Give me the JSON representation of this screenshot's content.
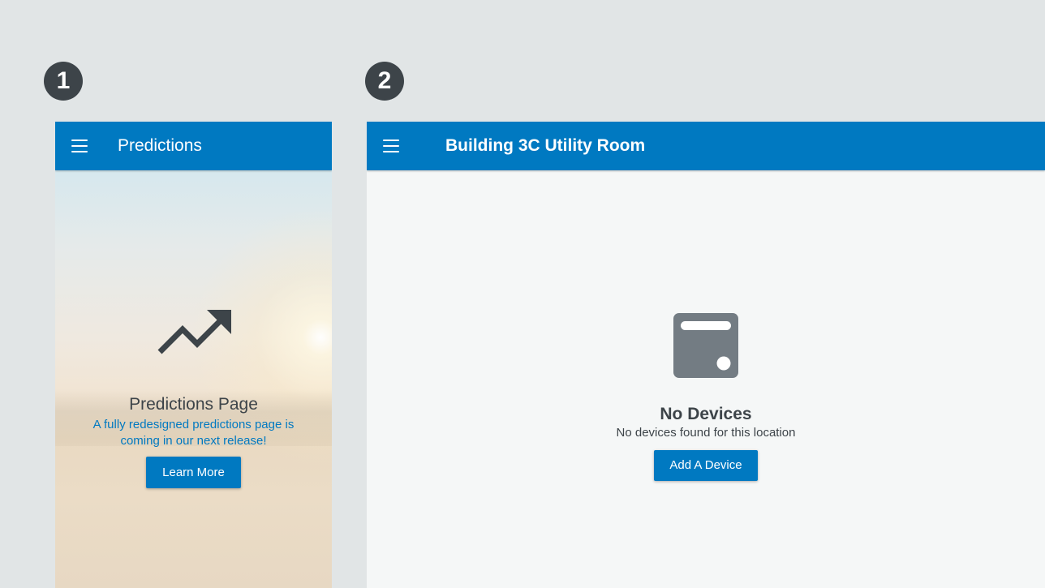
{
  "badges": [
    "1",
    "2"
  ],
  "predictions_screen": {
    "title": "Predictions",
    "heading": "Predictions Page",
    "description": "A fully redesigned predictions page is coming in our next release!",
    "button_label": "Learn More",
    "icon": "trending-up-icon"
  },
  "devices_screen": {
    "title": "Building 3C Utility Room",
    "empty_title": "No Devices",
    "empty_description": "No devices found for this location",
    "button_label": "Add A Device",
    "icon": "device-icon"
  },
  "colors": {
    "appbar": "#0079c1",
    "accent": "#0079c1",
    "text_dark": "#3d4449",
    "badge": "#3d4449",
    "page_background": "#e1e5e6",
    "panel_background": "#f5f7f7",
    "icon_gray": "#737c83"
  }
}
